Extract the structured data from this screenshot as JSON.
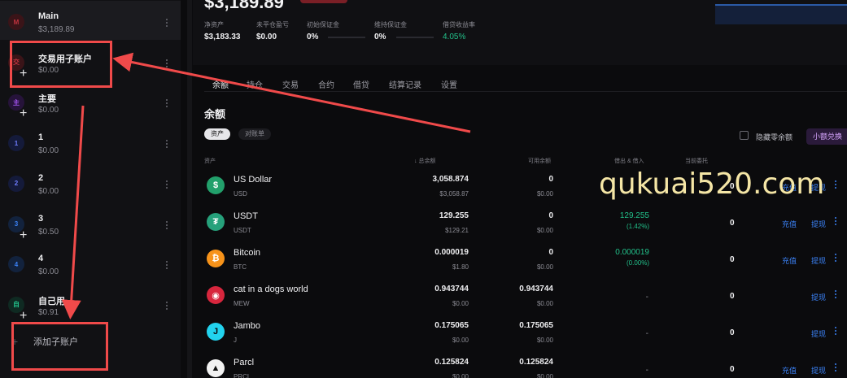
{
  "sidebar": {
    "items": [
      {
        "avatar": "M",
        "avatar_color": "#c2333f",
        "avatar_bg": "#3a1418",
        "name": "Main",
        "balance": "$3,189.89",
        "badge": false
      },
      {
        "avatar": "交",
        "avatar_color": "#c2333f",
        "avatar_bg": "#3a1418",
        "name": "交易用子账户",
        "balance": "$0.00",
        "badge": true
      },
      {
        "avatar": "主",
        "avatar_color": "#a855f7",
        "avatar_bg": "#26133a",
        "name": "主要",
        "balance": "$0.00",
        "badge": true
      },
      {
        "avatar": "1",
        "avatar_color": "#6f7dff",
        "avatar_bg": "#141a3a",
        "name": "1",
        "balance": "$0.00",
        "badge": false
      },
      {
        "avatar": "2",
        "avatar_color": "#6f7dff",
        "avatar_bg": "#141a3a",
        "name": "2",
        "balance": "$0.00",
        "badge": false
      },
      {
        "avatar": "3",
        "avatar_color": "#3b82f6",
        "avatar_bg": "#12223d",
        "name": "3",
        "balance": "$0.50",
        "badge": true
      },
      {
        "avatar": "4",
        "avatar_color": "#3b82f6",
        "avatar_bg": "#12223d",
        "name": "4",
        "balance": "$0.00",
        "badge": false
      },
      {
        "avatar": "自",
        "avatar_color": "#22c08a",
        "avatar_bg": "#0f2a22",
        "name": "自己用",
        "balance": "$0.91",
        "badge": true
      }
    ],
    "add_label": "添加子账户",
    "add_icon": "+"
  },
  "header": {
    "big_value": "$3,189.89",
    "kpis": [
      {
        "label": "净资产",
        "value": "$3,183.33"
      },
      {
        "label": "未平仓盈亏",
        "value": "$0.00"
      },
      {
        "label": "初始保证金",
        "value": "0%"
      },
      {
        "label": "维持保证金",
        "value": "0%"
      },
      {
        "label": "借贷收益率",
        "value": "4.05%"
      }
    ]
  },
  "tabs": [
    "余额",
    "持仓",
    "交易",
    "合约",
    "借贷",
    "结算记录",
    "设置"
  ],
  "section": {
    "title": "余额",
    "pill_assets": "资产",
    "pill_statement": "对账单",
    "hide_zero": "隐藏零余额",
    "small_convert": "小额兑换"
  },
  "table": {
    "headers": {
      "asset": "资产",
      "total": "总余额",
      "available": "可用余额",
      "borrow_lend": "借出 & 借入",
      "orders": "当前委托"
    },
    "rows": [
      {
        "icon": "$",
        "icon_bg": "#22a06b",
        "icon_color": "#ffffff",
        "name": "US Dollar",
        "symbol": "USD",
        "total": "3,058.874",
        "total_usd": "$3,058.87",
        "avail": "0",
        "avail_usd": "$0.00",
        "bl": "",
        "bl_sub": "",
        "orders": "0",
        "deposit": "充值",
        "withdraw": "提现"
      },
      {
        "icon": "₮",
        "icon_bg": "#26a17b",
        "icon_color": "#ffffff",
        "name": "USDT",
        "symbol": "USDT",
        "total": "129.255",
        "total_usd": "$129.21",
        "avail": "0",
        "avail_usd": "$0.00",
        "bl": "129.255",
        "bl_sub": "(1.42%)",
        "orders": "0",
        "deposit": "充值",
        "withdraw": "提现"
      },
      {
        "icon": "₿",
        "icon_bg": "#f7931a",
        "icon_color": "#ffffff",
        "name": "Bitcoin",
        "symbol": "BTC",
        "total": "0.000019",
        "total_usd": "$1.80",
        "avail": "0",
        "avail_usd": "$0.00",
        "bl": "0.000019",
        "bl_sub": "(0.00%)",
        "orders": "0",
        "deposit": "充值",
        "withdraw": "提现"
      },
      {
        "icon": "◉",
        "icon_bg": "#d7263d",
        "icon_color": "#ffffff",
        "name": "cat in a dogs world",
        "symbol": "MEW",
        "total": "0.943744",
        "total_usd": "$0.00",
        "avail": "0.943744",
        "avail_usd": "$0.00",
        "bl": "-",
        "bl_sub": "",
        "orders": "0",
        "deposit": "",
        "withdraw": "提现"
      },
      {
        "icon": "J",
        "icon_bg": "#22d3ee",
        "icon_color": "#0b0b0d",
        "name": "Jambo",
        "symbol": "J",
        "total": "0.175065",
        "total_usd": "$0.00",
        "avail": "0.175065",
        "avail_usd": "$0.00",
        "bl": "-",
        "bl_sub": "",
        "orders": "0",
        "deposit": "",
        "withdraw": "提现"
      },
      {
        "icon": "▲",
        "icon_bg": "#f2f2f2",
        "icon_color": "#111111",
        "name": "Parcl",
        "symbol": "PRCL",
        "total": "0.125824",
        "total_usd": "$0.00",
        "avail": "0.125824",
        "avail_usd": "$0.00",
        "bl": "-",
        "bl_sub": "",
        "orders": "0",
        "deposit": "充值",
        "withdraw": "提现"
      }
    ]
  },
  "watermark": "qukuai520.com"
}
